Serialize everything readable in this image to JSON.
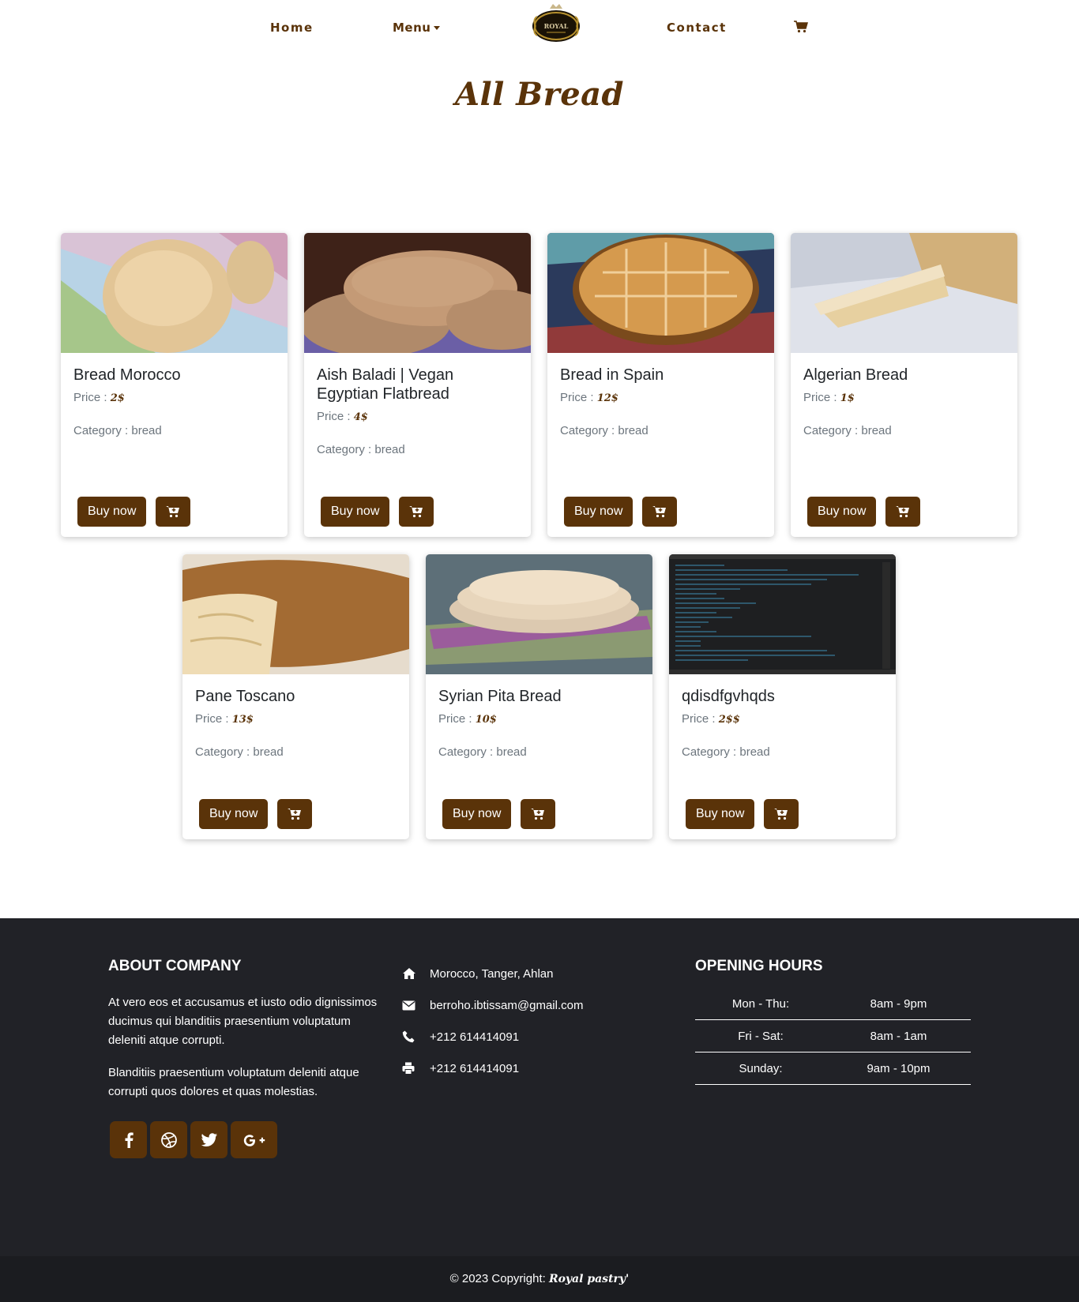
{
  "nav": {
    "home": "Home",
    "menu": "Menu",
    "contact": "Contact",
    "logo_text": "ROYAL"
  },
  "page": {
    "title": "All Bread"
  },
  "labels": {
    "price": "Price : ",
    "category": "Category : ",
    "buy_now": "Buy now"
  },
  "products": [
    {
      "name": "Bread Morocco",
      "price": "2$",
      "category": "bread"
    },
    {
      "name": "Aish Baladi | Vegan Egyptian Flatbread",
      "price": "4$",
      "category": "bread"
    },
    {
      "name": "Bread in Spain",
      "price": "12$",
      "category": "bread"
    },
    {
      "name": "Algerian Bread",
      "price": "1$",
      "category": "bread"
    },
    {
      "name": "Pane Toscano",
      "price": "13$",
      "category": "bread"
    },
    {
      "name": "Syrian Pita Bread",
      "price": "10$",
      "category": "bread"
    },
    {
      "name": "qdisdfgvhqds",
      "price": "2$$",
      "category": "bread"
    }
  ],
  "footer": {
    "about_title": "ABOUT COMPANY",
    "about_p1": "At vero eos et accusamus et iusto odio dignissimos ducimus qui blanditiis praesentium voluptatum deleniti atque corrupti.",
    "about_p2": "Blanditiis praesentium voluptatum deleniti atque corrupti quos dolores et quas molestias.",
    "socials": [
      "facebook-icon",
      "dribbble-icon",
      "twitter-icon",
      "google-plus-icon"
    ],
    "contact": {
      "address": "Morocco, Tanger, Ahlan",
      "email": "berroho.ibtissam@gmail.com",
      "phone": "+212 614414091",
      "fax": "+212 614414091"
    },
    "hours_title": "OPENING HOURS",
    "hours": [
      {
        "day": "Mon - Thu:",
        "time": "8am - 9pm"
      },
      {
        "day": "Fri - Sat:",
        "time": "8am - 1am"
      },
      {
        "day": "Sunday:",
        "time": "9am - 10pm"
      }
    ]
  },
  "copyright": {
    "text": "© 2023 Copyright: ",
    "brand": "Royal pastry'"
  },
  "colors": {
    "brand": "#5a3309",
    "footer_bg": "#212227",
    "copyright_bg": "#1b1c20"
  }
}
